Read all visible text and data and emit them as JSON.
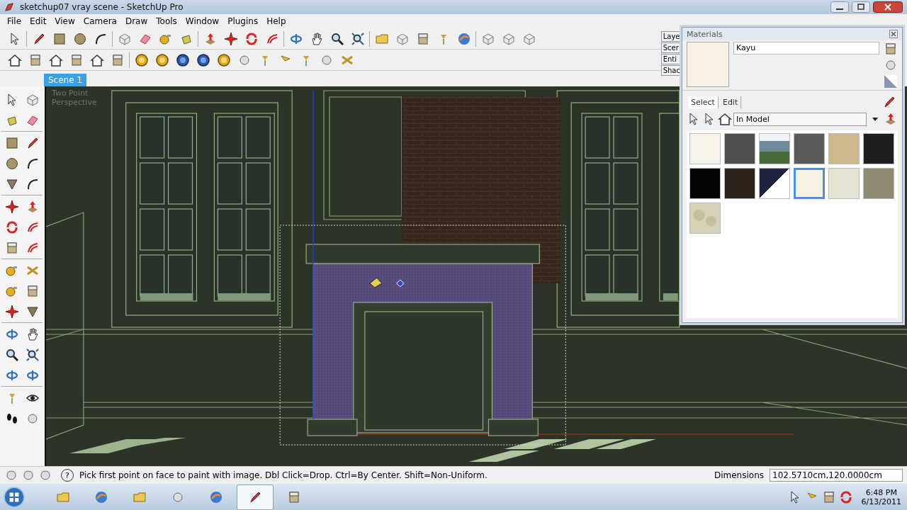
{
  "window": {
    "title": "sketchup07 vray scene - SketchUp Pro"
  },
  "menu": [
    "File",
    "Edit",
    "View",
    "Camera",
    "Draw",
    "Tools",
    "Window",
    "Plugins",
    "Help"
  ],
  "tray_tabs": [
    "Laye",
    "Scer",
    "Enti",
    "Shac"
  ],
  "scene_tabs": [
    {
      "label": "Scene 1",
      "selected": true
    }
  ],
  "viewport": {
    "camera_label": "Two Point Perspective"
  },
  "materials": {
    "title": "Materials",
    "name": "Kayu",
    "tabs": [
      {
        "label": "Select",
        "selected": true
      },
      {
        "label": "Edit",
        "selected": false
      }
    ],
    "collection": "In Model",
    "swatches": [
      {
        "kind": "solid",
        "color": "#f7f3e8",
        "selected": false
      },
      {
        "kind": "solid",
        "color": "#4e4e4e",
        "selected": false
      },
      {
        "kind": "photo",
        "color": "#6f8a99",
        "selected": false
      },
      {
        "kind": "solid",
        "color": "#5b5b5b",
        "selected": false
      },
      {
        "kind": "solid",
        "color": "#cdb88e",
        "selected": false
      },
      {
        "kind": "solid",
        "color": "#1f1f1f",
        "selected": false
      },
      {
        "kind": "solid",
        "color": "#050505",
        "selected": false
      },
      {
        "kind": "solid",
        "color": "#2e2218",
        "selected": false
      },
      {
        "kind": "split",
        "color": "#1c2440",
        "selected": false
      },
      {
        "kind": "solid",
        "color": "#f7f2e4",
        "selected": true
      },
      {
        "kind": "solid",
        "color": "#e6e2d2",
        "selected": false
      },
      {
        "kind": "solid",
        "color": "#8e8b72",
        "selected": false
      },
      {
        "kind": "texture",
        "color": "#d6d2b8",
        "selected": false
      }
    ]
  },
  "status_bar": {
    "help_icon": "?",
    "hint": "Pick first point on face to paint with image. Dbl Click=Drop. Ctrl=By Center. Shift=Non-Uniform.",
    "measure_label": "Dimensions",
    "measure_value": "102.5710cm,120.0000cm"
  },
  "taskbar": {
    "time": "6:48 PM",
    "date": "6/13/2011"
  }
}
